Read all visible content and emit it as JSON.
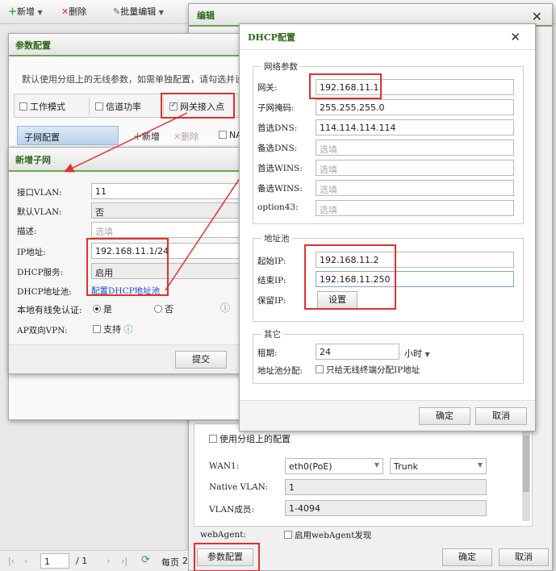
{
  "colors": {
    "accent_green": "#6aa84f",
    "title_green": "#2e6a1c",
    "highlight_red": "#e03030",
    "link_blue": "#1a4fd0"
  },
  "toolbar": {
    "add_label": "新增",
    "delete_label": "删除",
    "batch_edit_label": "批量编辑"
  },
  "edit_panel": {
    "title": "编辑",
    "use_group_config_label": "使用分组上的配置",
    "wan1_label": "WAN1:",
    "wan1_iface": "eth0(PoE)",
    "wan1_mode": "Trunk",
    "native_vlan_label": "Native VLAN:",
    "native_vlan_value": "1",
    "vlan_members_label": "VLAN成员:",
    "vlan_members_value": "1-4094",
    "webagent_label": "webAgent:",
    "webagent_option": "启用webAgent发现",
    "param_config_button": "参数配置",
    "ok_button": "确定",
    "cancel_button": "取消"
  },
  "pager": {
    "page_value": "1",
    "page_total": "/ 1",
    "per_page_label": "每页",
    "per_page_value": "2"
  },
  "param_dialog": {
    "title": "参数配置",
    "hint": "默认使用分组上的无线参数，如需单独配置，请勾选并设置",
    "tabs": [
      "工作模式",
      "信道功率",
      "网关接入点"
    ],
    "subnet_tab": "子网配置",
    "add_label": "新增",
    "delete_label": "删除",
    "nat_label": "NA"
  },
  "subnet_dialog": {
    "title": "新增子网",
    "fields": [
      {
        "label": "接口VLAN:",
        "value": "11"
      },
      {
        "label": "默认VLAN:",
        "value": "否"
      },
      {
        "label": "描述:",
        "value": "选填"
      },
      {
        "label": "IP地址:",
        "value": "192.168.11.1/24"
      },
      {
        "label": "DHCP服务:",
        "value": "启用"
      }
    ],
    "dhcp_pool_label": "DHCP地址池:",
    "dhcp_pool_link": "配置DHCP地址池",
    "local_auth_label": "本地有线免认证:",
    "yes_label": "是",
    "no_label": "否",
    "ap_vpn_label": "AP双向VPN:",
    "support_label": "支持",
    "submit_button": "提交"
  },
  "dhcp_dialog": {
    "title": "DHCP配置",
    "network_group": "网络参数",
    "network_fields": [
      {
        "label": "网关:",
        "value": "192.168.11.1"
      },
      {
        "label": "子网掩码:",
        "value": "255.255.255.0"
      },
      {
        "label": "首选DNS:",
        "value": "114.114.114.114"
      },
      {
        "label": "备选DNS:",
        "value": "选填"
      },
      {
        "label": "首选WINS:",
        "value": "选填"
      },
      {
        "label": "备选WINS:",
        "value": "选填"
      },
      {
        "label": "option43:",
        "value": "选填"
      }
    ],
    "pool_group": "地址池",
    "start_ip_label": "起始IP:",
    "start_ip_value": "192.168.11.2",
    "end_ip_label": "结束IP:",
    "end_ip_value": "192.168.11.250",
    "reserved_ip_label": "保留IP:",
    "reserved_button": "设置",
    "other_group": "其它",
    "lease_label": "租期:",
    "lease_value": "24",
    "lease_unit": "小时",
    "pool_alloc_label": "地址池分配:",
    "pool_alloc_option": "只给无线终端分配IP地址",
    "ok_button": "确定",
    "cancel_button": "取消"
  }
}
